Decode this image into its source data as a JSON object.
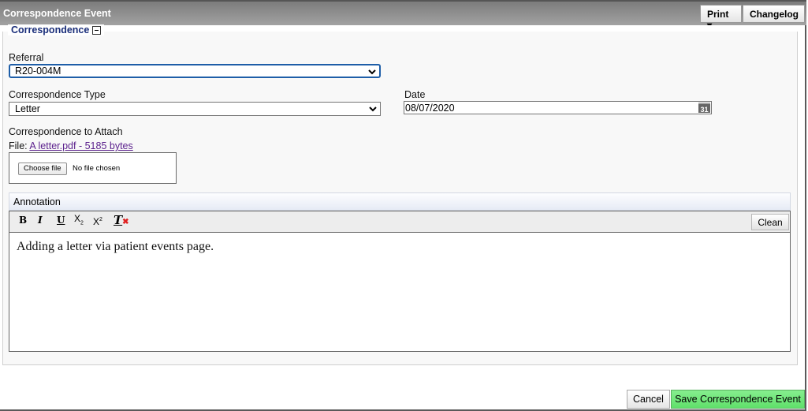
{
  "header": {
    "title": "Correspondence Event",
    "print_label": "Print ▾",
    "changelog_label": "Changelog"
  },
  "section": {
    "legend": "Correspondence",
    "collapse_icon": "minus-box-icon"
  },
  "form": {
    "referral": {
      "label": "Referral",
      "value": "R20-004M"
    },
    "correspondence_type": {
      "label": "Correspondence Type",
      "value": "Letter"
    },
    "date": {
      "label": "Date",
      "value": "08/07/2020",
      "icon": "calendar-icon",
      "icon_text": "31"
    },
    "attach": {
      "label": "Correspondence to Attach",
      "file_prefix": "File: ",
      "file_link": "A letter.pdf - 5185 bytes",
      "choose_label": "Choose file",
      "no_file": "No file chosen"
    }
  },
  "annotation": {
    "label": "Annotation",
    "toolbar": {
      "bold": "B",
      "italic": "I",
      "underline": "U",
      "subscript": "X",
      "sub_mark": "2",
      "superscript": "X",
      "sup_mark": "2",
      "clear_format": "T",
      "clean_label": "Clean"
    },
    "content": "Adding a letter via patient events page."
  },
  "footer": {
    "cancel_label": "Cancel",
    "save_label": "Save Correspondence Event"
  },
  "colors": {
    "legend_text": "#1a2e7a",
    "link": "#5a1f8c",
    "save_button": "#6fe679",
    "focus_border": "#1e5ea8"
  }
}
